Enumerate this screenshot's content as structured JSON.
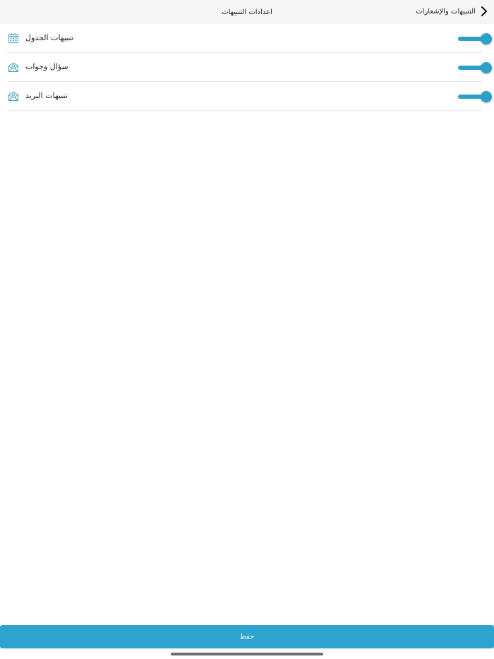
{
  "header": {
    "title": "اعدادات التنبيهات",
    "back_label": "التنبيهات والإشعارات",
    "back_icon": "chevron-back-icon"
  },
  "settings": [
    {
      "label": "تنبيهات الجدول",
      "icon": "calendar-icon",
      "enabled": true
    },
    {
      "label": "سؤال وجواب",
      "icon": "mail-open-icon",
      "enabled": true
    },
    {
      "label": "تنبيهات البريد",
      "icon": "mail-open-icon",
      "enabled": true
    }
  ],
  "save_label": "حفظ",
  "colors": {
    "accent": "#2ca0c8",
    "button": "#2ea3cd",
    "header_bg": "#f6f6f6",
    "icon": "#3a9fc0"
  }
}
